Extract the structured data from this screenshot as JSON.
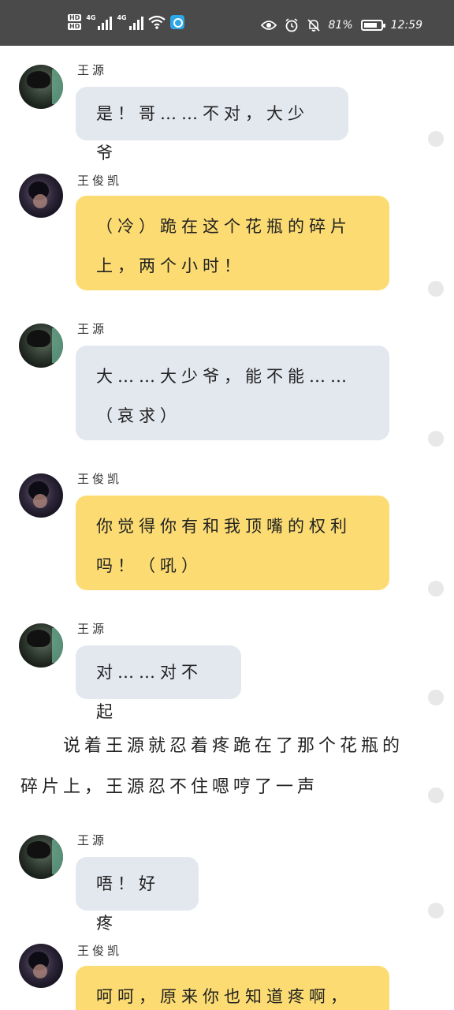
{
  "status_bar": {
    "hd1": "HD",
    "hd2": "HD",
    "net1": "4G",
    "net2": "4G",
    "battery_percent": "81%",
    "battery_level": 0.81,
    "time": "12:59",
    "icons": [
      "eye-icon",
      "alarm-icon",
      "bell-muted-icon",
      "battery-icon",
      "wifi-icon",
      "app-icon"
    ]
  },
  "messages": [
    {
      "speaker": "王源",
      "text": "是！哥……不对，大少爷",
      "style": "grey"
    },
    {
      "speaker": "王俊凯",
      "line1": "（冷）跪在这个花瓶的碎片",
      "line2": "上，两个小时！",
      "style": "yellow"
    },
    {
      "speaker": "王源",
      "line1": "大……大少爷，能不能……",
      "line2": "（哀求）",
      "style": "grey"
    },
    {
      "speaker": "王俊凯",
      "line1": "你觉得你有和我顶嘴的权利",
      "line2": "吗！（吼）",
      "style": "yellow"
    },
    {
      "speaker": "王源",
      "text": "对……对不起",
      "style": "grey"
    },
    {
      "speaker": "王源",
      "text": "唔！好疼",
      "style": "grey"
    },
    {
      "speaker": "王俊凯",
      "text": "呵呵，原来你也知道疼啊，",
      "style": "yellow"
    }
  ],
  "narration": "说着王源就忍着疼跪在了那个花瓶的碎片上，王源忍不住嗯哼了一声",
  "colors": {
    "grey_bubble": "#e3e7ee",
    "yellow_bubble": "#fcdc72",
    "status_bar": "#4a4a4a"
  }
}
